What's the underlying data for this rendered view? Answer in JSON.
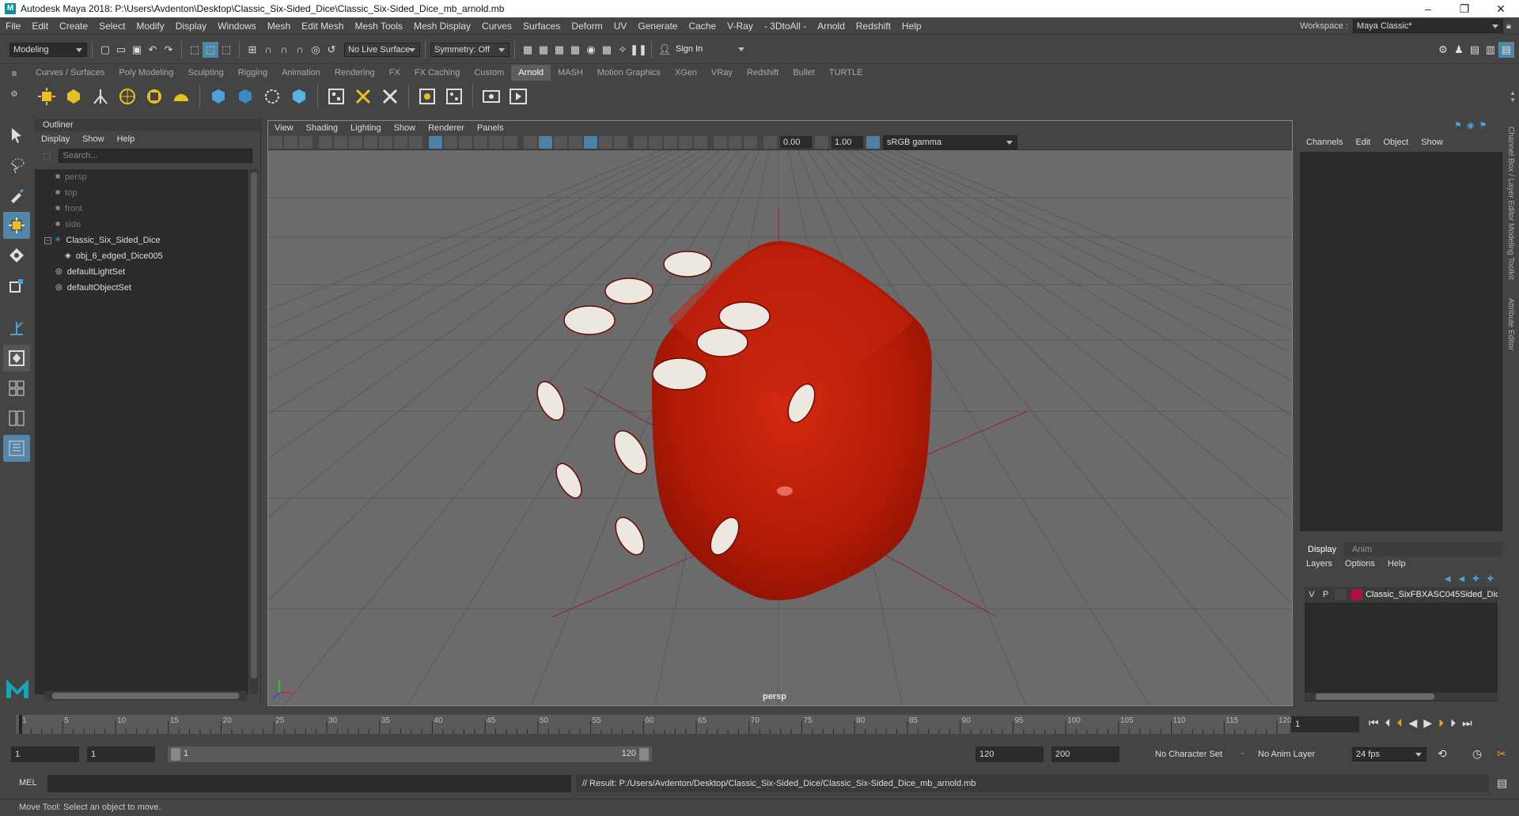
{
  "window": {
    "title": "Autodesk Maya 2018: P:\\Users\\Avdenton\\Desktop\\Classic_Six-Sided_Dice\\Classic_Six-Sided_Dice_mb_arnold.mb",
    "minimize": "–",
    "maximize": "❐",
    "close": "✕"
  },
  "menubar": {
    "items": [
      "File",
      "Edit",
      "Create",
      "Select",
      "Modify",
      "Display",
      "Windows",
      "Mesh",
      "Edit Mesh",
      "Mesh Tools",
      "Mesh Display",
      "Curves",
      "Surfaces",
      "Deform",
      "UV",
      "Generate",
      "Cache",
      "V-Ray",
      "- 3DtoAll -",
      "Arnold",
      "Redshift",
      "Help"
    ],
    "workspace_label": "Workspace :",
    "workspace_value": "Maya Classic*"
  },
  "statusline": {
    "mode": "Modeling",
    "live_surface": "No Live Surface",
    "symmetry": "Symmetry: Off",
    "sign_in": "Sign In"
  },
  "shelf": {
    "tabs": [
      "Curves / Surfaces",
      "Poly Modeling",
      "Sculpting",
      "Rigging",
      "Animation",
      "Rendering",
      "FX",
      "FX Caching",
      "Custom",
      "Arnold",
      "MASH",
      "Motion Graphics",
      "XGen",
      "VRay",
      "Redshift",
      "Bullet",
      "TURTLE"
    ],
    "active": "Arnold"
  },
  "outliner": {
    "title": "Outliner",
    "menu": [
      "Display",
      "Show",
      "Help"
    ],
    "search_placeholder": "Search...",
    "items": [
      {
        "label": "persp",
        "type": "camera"
      },
      {
        "label": "top",
        "type": "camera"
      },
      {
        "label": "front",
        "type": "camera"
      },
      {
        "label": "side",
        "type": "camera"
      },
      {
        "label": "Classic_Six_Sided_Dice",
        "type": "group"
      },
      {
        "label": "obj_6_edged_Dice005",
        "type": "mesh"
      },
      {
        "label": "defaultLightSet",
        "type": "set"
      },
      {
        "label": "defaultObjectSet",
        "type": "set"
      }
    ]
  },
  "viewport": {
    "menu": [
      "View",
      "Shading",
      "Lighting",
      "Show",
      "Renderer",
      "Panels"
    ],
    "exposure": "0.00",
    "gamma": "1.00",
    "color_space": "sRGB gamma",
    "camera_label": "persp",
    "dice_color": "#b81c08",
    "pip_color": "#ece8df"
  },
  "channelbox": {
    "menu": [
      "Channels",
      "Edit",
      "Object",
      "Show"
    ],
    "side_tabs": [
      "Channel Box / Layer Editor",
      "Modeling Toolkit",
      "Attribute Editor"
    ]
  },
  "layers": {
    "tabs": [
      "Display",
      "Anim"
    ],
    "menu": [
      "Layers",
      "Options",
      "Help"
    ],
    "layer": {
      "v": "V",
      "p": "P",
      "name": "Classic_SixFBXASC045Sided_Dic",
      "color": "#b0103a"
    }
  },
  "timeline": {
    "ticks": [
      "1",
      "5",
      "10",
      "15",
      "20",
      "25",
      "30",
      "35",
      "40",
      "45",
      "50",
      "55",
      "60",
      "65",
      "70",
      "75",
      "80",
      "85",
      "90",
      "95",
      "100",
      "105",
      "110",
      "115",
      "120"
    ],
    "current_frame": "1"
  },
  "range": {
    "start": "1",
    "start_inner": "1",
    "slider_start": "1",
    "slider_end": "120",
    "end_inner": "120",
    "end": "200",
    "character_set": "No Character Set",
    "anim_layer": "No Anim Layer",
    "fps": "24 fps"
  },
  "command": {
    "label": "MEL",
    "result": "// Result: P:/Users/Avdenton/Desktop/Classic_Six-Sided_Dice/Classic_Six-Sided_Dice_mb_arnold.mb"
  },
  "help_line": "Move Tool: Select an object to move."
}
